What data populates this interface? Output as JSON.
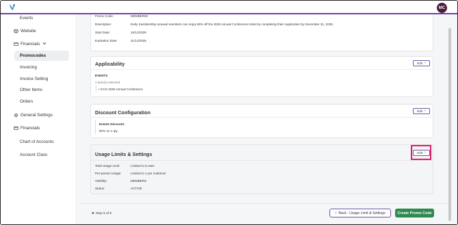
{
  "header": {
    "avatar_initials": "MC"
  },
  "sidebar": {
    "items": [
      {
        "label": "Events"
      },
      {
        "label": "Website"
      },
      {
        "label": "Financials"
      },
      {
        "label": "Promocodes"
      },
      {
        "label": "Invoicing"
      },
      {
        "label": "Invoice Setting"
      },
      {
        "label": "Other Items"
      },
      {
        "label": "Orders"
      },
      {
        "label": "General Settings"
      },
      {
        "label": "Financials"
      },
      {
        "label": "Chart of Accounts"
      },
      {
        "label": "Account Class"
      }
    ]
  },
  "details": {
    "promo_code_label": "Promo Code:",
    "promo_code_value": "MEMBER50",
    "description_label": "Description:",
    "description_value": "Early membership renewal members can enjoy 50% off the 2026 Annual Conference ticket by completing their registration by December 31, 2025.",
    "start_label": "Start Date:",
    "start_value": "15/12/2025",
    "expiration_label": "Expiration Date:",
    "expiration_value": "31/12/2025"
  },
  "applicability": {
    "title": "Applicability",
    "edit_label": "Edit",
    "events_heading": "EVENTS",
    "selected_count": "1 item(s) selected",
    "event_item": "• CCG 2026 Annual Conference"
  },
  "discount": {
    "title": "Discount Configuration",
    "edit_label": "Edit",
    "events_discount_label": "Events Discount:",
    "discount_value": "50% on 1 qty."
  },
  "usage": {
    "title": "Usage Limits & Settings",
    "edit_label": "Edit",
    "rows": [
      {
        "label": "Total Usage Limit:",
        "value": "Limited to 5 uses"
      },
      {
        "label": "Per-person Usage:",
        "value": "Limited to 1 per customer"
      },
      {
        "label": "Visibility:",
        "value": "MEMBERS"
      },
      {
        "label": "Status:",
        "value": "ACTIVE"
      }
    ]
  },
  "footer": {
    "step_text": "Step 5 of 5",
    "back_label": "Back : Usage Limit & Settings",
    "create_label": "Create Promo Code"
  },
  "colors": {
    "accent": "#6b3fa0",
    "primary_green": "#2f8a4f",
    "highlight": "#e0196a"
  }
}
